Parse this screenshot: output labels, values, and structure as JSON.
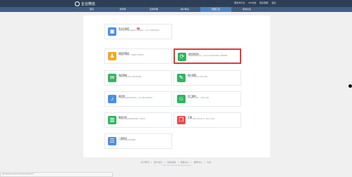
{
  "header": {
    "app_name": "企业微信",
    "links": [
      "服务商平台",
      "API文档",
      "联系客服",
      "退出"
    ]
  },
  "nav": {
    "items": [
      "首页",
      "通讯录",
      "应用管理",
      "客户联系",
      "管理工具",
      "我的企业"
    ]
  },
  "cards": [
    {
      "name": "card-security",
      "title": "安全与保密",
      "badge": "新",
      "desc": "企业可通过水印等设置保护企业数据安全，让员工在使用时更安全",
      "color": "#4a90e2",
      "icon": "shield-icon",
      "glyph": "▣"
    },
    {
      "name": "card-admin",
      "title": "组织管理员",
      "badge": "",
      "desc": "可设置多个管理员，按权限分工管理企业",
      "color": "#f5a623",
      "icon": "people-icon",
      "glyph": "♟"
    },
    {
      "name": "card-data-sync",
      "title": "通讯录同步",
      "badge": "",
      "desc": "可通过API或同步助手，同步企业已有通讯录数据，管理更便捷",
      "color": "#2fb560",
      "icon": "sync-icon",
      "glyph": "⟳"
    },
    {
      "name": "card-announce",
      "title": "消息群发",
      "badge": "",
      "desc": "可通过企业微信给员工群发消息通知",
      "color": "#2fb560",
      "icon": "chat-icon",
      "glyph": "✉"
    },
    {
      "name": "card-user-feedback",
      "title": "用户调研",
      "badge": "",
      "desc": "可通过调研收集员工意见与建议",
      "color": "#2fb560",
      "icon": "survey-icon",
      "glyph": "✎"
    },
    {
      "name": "card-accessibility",
      "title": "通讯录",
      "badge": "",
      "desc": "可查看成员的登录和使用情况，及时了解企业使用状况",
      "color": "#4a90e2",
      "icon": "bell-icon",
      "glyph": "♪"
    },
    {
      "name": "card-staff-service",
      "title": "员工服务",
      "badge": "",
      "desc": "可以设置员工服务，方便员工使用",
      "color": "#2fb560",
      "icon": "service-icon",
      "glyph": "☺"
    },
    {
      "name": "card-analytics",
      "title": "使用分析",
      "badge": "",
      "desc": "可查看企业成员的使用统计数据，管理企业",
      "color": "#2fb560",
      "icon": "chart-icon",
      "glyph": "▥"
    },
    {
      "name": "card-report",
      "title": "汇报",
      "badge": "",
      "desc": "员工可以通过汇报记录工作，提交工作日报",
      "color": "#e94b4b",
      "icon": "report-icon",
      "glyph": "❒"
    },
    {
      "name": "card-checklist",
      "title": "一键导出",
      "badge": "",
      "desc": "可快速导出企业的各类数据",
      "color": "#4a90e2",
      "icon": "doc-icon",
      "glyph": "☰"
    }
  ],
  "footer": {
    "links": [
      "关于腾讯",
      "用户协议",
      "隐私政策",
      "帮助中心",
      "推荐中心",
      "中文"
    ],
    "copyright": "© 1998 - 2024 Tencent Inc. All Rights Reserved"
  },
  "statusbar": {
    "url": "https://work.weixin.qq.com/wework_admin/frame#/"
  }
}
